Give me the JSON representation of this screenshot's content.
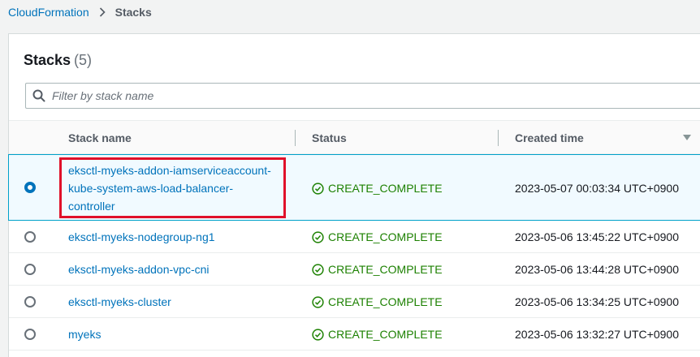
{
  "breadcrumb": {
    "root": "CloudFormation",
    "current": "Stacks"
  },
  "panel": {
    "title": "Stacks",
    "count": "(5)"
  },
  "search": {
    "placeholder": "Filter by stack name"
  },
  "columns": {
    "stack_name": "Stack name",
    "status": "Status",
    "created_time": "Created time"
  },
  "rows": [
    {
      "name_lines": [
        "eksctl-myeks-addon-iamserviceaccount-",
        "kube-system-aws-load-balancer-",
        "controller"
      ],
      "status": "CREATE_COMPLETE",
      "created": "2023-05-07 00:03:34 UTC+0900",
      "selected": true
    },
    {
      "name": "eksctl-myeks-nodegroup-ng1",
      "status": "CREATE_COMPLETE",
      "created": "2023-05-06 13:45:22 UTC+0900",
      "selected": false
    },
    {
      "name": "eksctl-myeks-addon-vpc-cni",
      "status": "CREATE_COMPLETE",
      "created": "2023-05-06 13:44:28 UTC+0900",
      "selected": false
    },
    {
      "name": "eksctl-myeks-cluster",
      "status": "CREATE_COMPLETE",
      "created": "2023-05-06 13:34:25 UTC+0900",
      "selected": false
    },
    {
      "name": "myeks",
      "status": "CREATE_COMPLETE",
      "created": "2023-05-06 13:32:27 UTC+0900",
      "selected": false
    }
  ],
  "colors": {
    "link": "#0073bb",
    "success": "#1d8102",
    "highlight": "#e0102a",
    "selected_bg": "#f1faff"
  },
  "icons": {
    "breadcrumb_separator": "chevron-right-icon",
    "search": "search-icon",
    "status": "check-circle-icon",
    "sort": "caret-down-icon"
  }
}
